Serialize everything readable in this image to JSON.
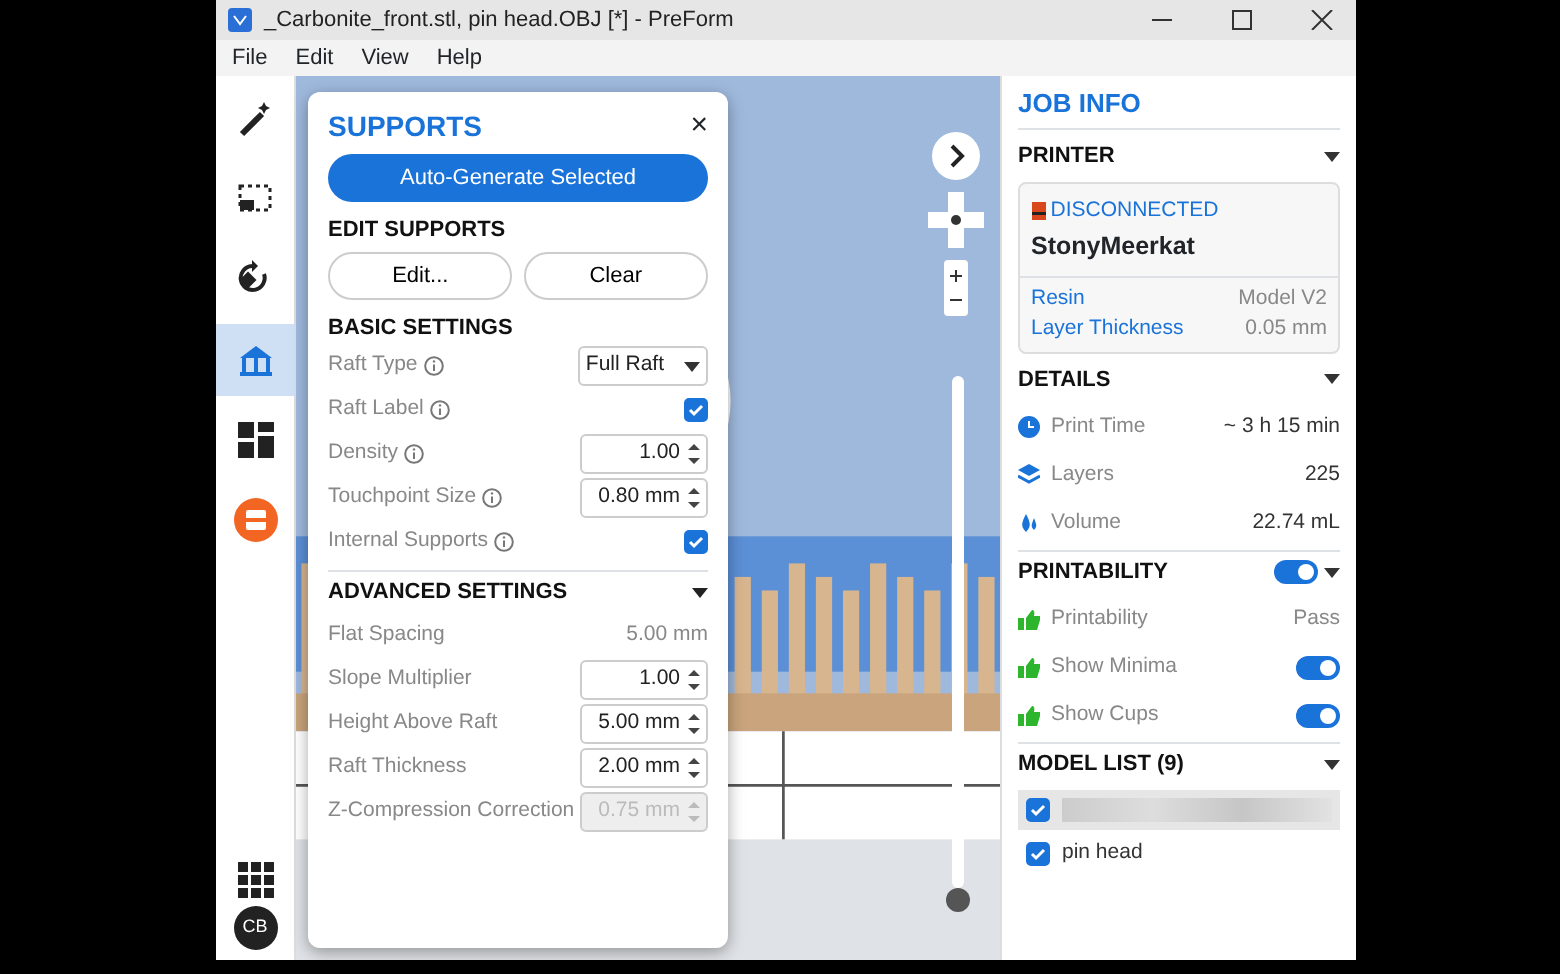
{
  "window": {
    "title": "_Carbonite_front.stl, pin head.OBJ [*] - PreForm"
  },
  "menu": [
    "File",
    "Edit",
    "View",
    "Help"
  ],
  "toolbar": [
    {
      "kind": "wand",
      "selected": false
    },
    {
      "kind": "select",
      "selected": false
    },
    {
      "kind": "rotate",
      "selected": false
    },
    {
      "kind": "supports",
      "selected": true
    },
    {
      "kind": "layout",
      "selected": false
    },
    {
      "kind": "print",
      "selected": false
    }
  ],
  "account": {
    "initials": "CB"
  },
  "viewport": {
    "layer_slider": {
      "level": 0
    }
  },
  "supports_panel": {
    "title": "SUPPORTS",
    "close": "×",
    "auto_generate": "Auto-Generate Selected",
    "edit_supports": {
      "heading": "EDIT SUPPORTS",
      "buttons": [
        "Edit...",
        "Clear"
      ]
    },
    "basic_settings": {
      "heading": "BASIC SETTINGS",
      "rows": [
        {
          "label": "Raft Type",
          "info": true,
          "kind": "select",
          "value": "Full Raft"
        },
        {
          "label": "Raft Label",
          "info": true,
          "kind": "checkbox",
          "checked": true
        },
        {
          "label": "Density",
          "info": true,
          "kind": "number",
          "value": "1.00",
          "disabled": false
        },
        {
          "label": "Touchpoint Size",
          "info": true,
          "kind": "number",
          "value": "0.80 mm",
          "disabled": false
        },
        {
          "label": "Internal Supports",
          "info": true,
          "kind": "checkbox",
          "checked": true
        }
      ]
    },
    "advanced_settings": {
      "heading": "ADVANCED SETTINGS",
      "expanded": true,
      "rows": [
        {
          "label": "Flat Spacing",
          "info": false,
          "kind": "text",
          "value": "5.00 mm"
        },
        {
          "label": "Slope Multiplier",
          "info": false,
          "kind": "number",
          "value": "1.00",
          "disabled": false
        },
        {
          "label": "Height Above Raft",
          "info": false,
          "kind": "number",
          "value": "5.00 mm",
          "disabled": false
        },
        {
          "label": "Raft Thickness",
          "info": false,
          "kind": "number",
          "value": "2.00 mm",
          "disabled": false
        },
        {
          "label": "Z-Compression Correction",
          "info": false,
          "kind": "number",
          "value": "0.75 mm",
          "disabled": true
        }
      ]
    }
  },
  "job_info": {
    "title": "JOB INFO",
    "printer": {
      "heading": "PRINTER",
      "status": "DISCONNECTED",
      "name": "StonyMeerkat",
      "props": [
        {
          "label": "Resin",
          "value": "Model V2"
        },
        {
          "label": "Layer Thickness",
          "value": "0.05 mm"
        }
      ]
    },
    "details": {
      "heading": "DETAILS",
      "rows": [
        {
          "kind": "clock",
          "label": "Print Time",
          "value": "~ 3 h 15 min"
        },
        {
          "kind": "layers",
          "label": "Layers",
          "value": "225"
        },
        {
          "kind": "volume",
          "label": "Volume",
          "value": "22.74 mL"
        }
      ]
    },
    "printability": {
      "heading": "PRINTABILITY",
      "on": true,
      "rows": [
        {
          "label": "Printability",
          "kind": "text",
          "value": "Pass"
        },
        {
          "label": "Show Minima",
          "kind": "toggle",
          "on": true
        },
        {
          "label": "Show Cups",
          "kind": "toggle",
          "on": true
        }
      ]
    },
    "model_list": {
      "heading": "MODEL LIST (9)",
      "items": [
        {
          "blurred": true,
          "checked": true,
          "selected": true
        },
        {
          "name": "pin head",
          "blurred": false,
          "checked": true,
          "selected": false
        }
      ]
    }
  }
}
